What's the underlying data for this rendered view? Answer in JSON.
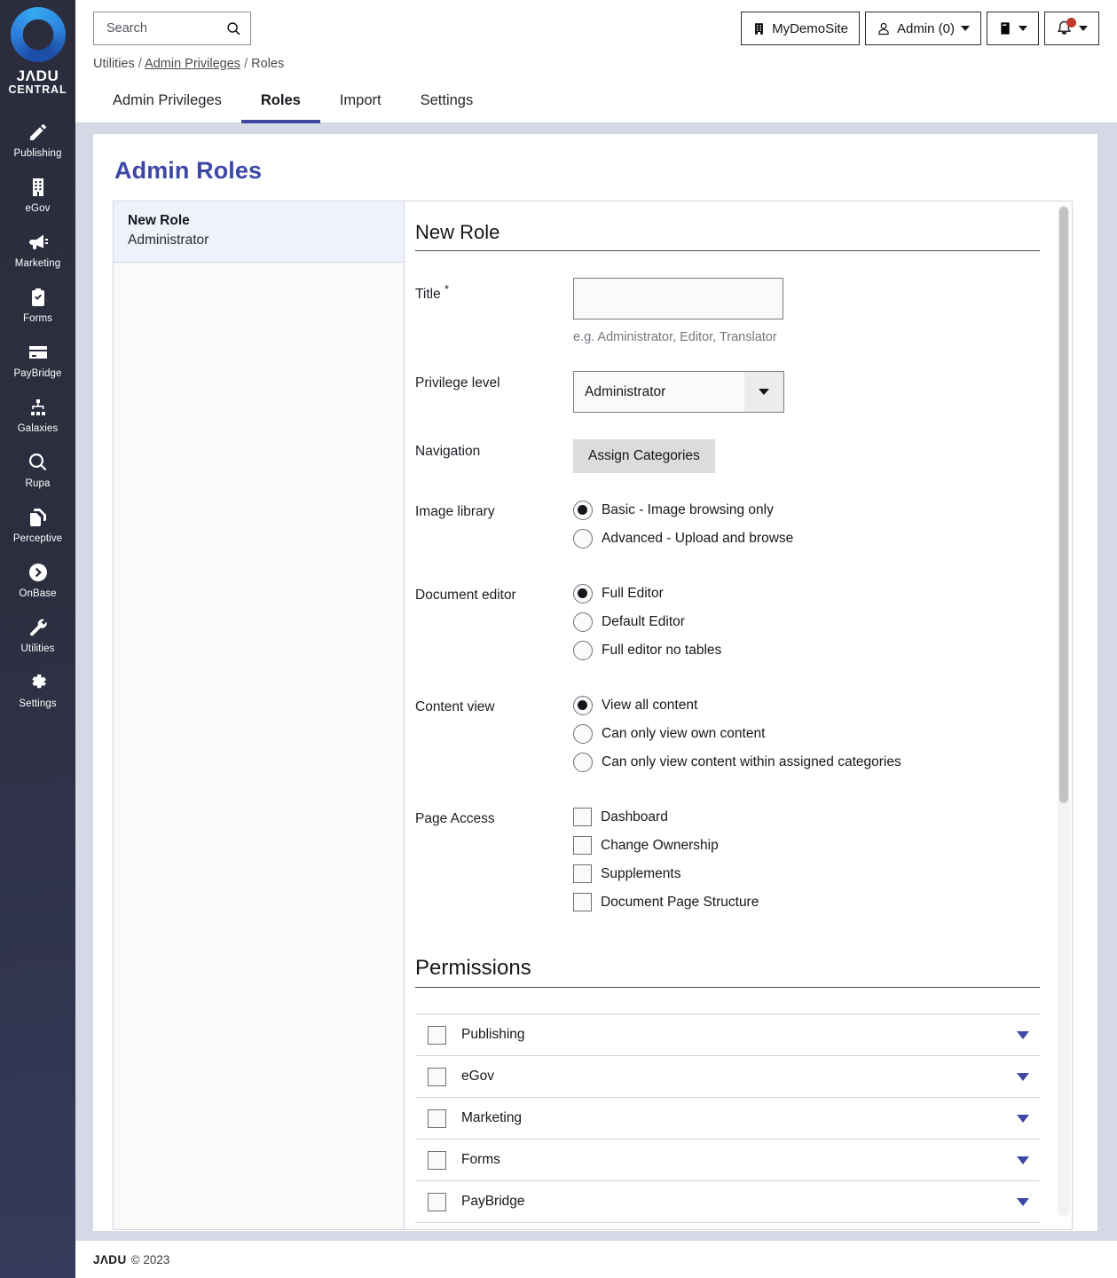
{
  "sidebar": {
    "logo": {
      "line1": "JΛDU",
      "line2": "CENTRAL"
    },
    "items": [
      {
        "label": "Publishing",
        "icon": "pencil-icon"
      },
      {
        "label": "eGov",
        "icon": "building-icon"
      },
      {
        "label": "Marketing",
        "icon": "megaphone-icon"
      },
      {
        "label": "Forms",
        "icon": "clipboard-check-icon"
      },
      {
        "label": "PayBridge",
        "icon": "credit-card-icon"
      },
      {
        "label": "Galaxies",
        "icon": "sitemap-icon"
      },
      {
        "label": "Rupa",
        "icon": "search-icon"
      },
      {
        "label": "Perceptive",
        "icon": "copy-documents-icon"
      },
      {
        "label": "OnBase",
        "icon": "arrow-circle-right-icon"
      },
      {
        "label": "Utilities",
        "icon": "wrench-icon"
      },
      {
        "label": "Settings",
        "icon": "gear-icon"
      }
    ]
  },
  "topbar": {
    "search_placeholder": "Search",
    "search_value": "",
    "search_icon": "magnifier-icon",
    "site_button": {
      "label": "MyDemoSite",
      "icon": "building-icon"
    },
    "admin_button": {
      "label": "Admin (0)",
      "icon": "person-icon"
    },
    "book_button": {
      "label": "",
      "icon": "book-icon"
    },
    "bell_button": {
      "label": "",
      "icon": "bell-icon",
      "has_alert": true,
      "alert_color": "#c0392b"
    }
  },
  "breadcrumb": {
    "root": "Utilities",
    "link": "Admin Privileges",
    "current": "Roles",
    "separator": "/"
  },
  "tabs": [
    {
      "label": "Admin Privileges",
      "active": false
    },
    {
      "label": "Roles",
      "active": true
    },
    {
      "label": "Import",
      "active": false
    },
    {
      "label": "Settings",
      "active": false
    }
  ],
  "page": {
    "title": "Admin Roles",
    "accent": "#3d48a6"
  },
  "role_list": [
    {
      "name": "New Role",
      "subtitle": "Administrator",
      "selected": true
    }
  ],
  "detail": {
    "heading": "New Role",
    "fields": {
      "title": {
        "label": "Title",
        "required_mark": "*",
        "value": "",
        "hint": "e.g. Administrator, Editor, Translator"
      },
      "privilege_level": {
        "label": "Privilege level",
        "value": "Administrator"
      },
      "navigation": {
        "label": "Navigation",
        "button": "Assign Categories"
      },
      "image_library": {
        "label": "Image library",
        "options": [
          {
            "label": "Basic - Image browsing only",
            "selected": true
          },
          {
            "label": "Advanced - Upload and browse",
            "selected": false
          }
        ]
      },
      "document_editor": {
        "label": "Document editor",
        "options": [
          {
            "label": "Full Editor",
            "selected": true
          },
          {
            "label": "Default Editor",
            "selected": false
          },
          {
            "label": "Full editor no tables",
            "selected": false
          }
        ]
      },
      "content_view": {
        "label": "Content view",
        "options": [
          {
            "label": "View all content",
            "selected": true
          },
          {
            "label": "Can only view own content",
            "selected": false
          },
          {
            "label": "Can only view content within assigned categories",
            "selected": false
          }
        ]
      },
      "page_access": {
        "label": "Page Access",
        "options": [
          {
            "label": "Dashboard",
            "checked": false
          },
          {
            "label": "Change Ownership",
            "checked": false
          },
          {
            "label": "Supplements",
            "checked": false
          },
          {
            "label": "Document Page Structure",
            "checked": false
          }
        ]
      }
    },
    "permissions": {
      "heading": "Permissions",
      "rows": [
        {
          "label": "Publishing",
          "checked": false
        },
        {
          "label": "eGov",
          "checked": false
        },
        {
          "label": "Marketing",
          "checked": false
        },
        {
          "label": "Forms",
          "checked": false
        },
        {
          "label": "PayBridge",
          "checked": false
        }
      ]
    }
  },
  "footer": {
    "brand": "JΛDU",
    "copyright": "© 2023"
  }
}
